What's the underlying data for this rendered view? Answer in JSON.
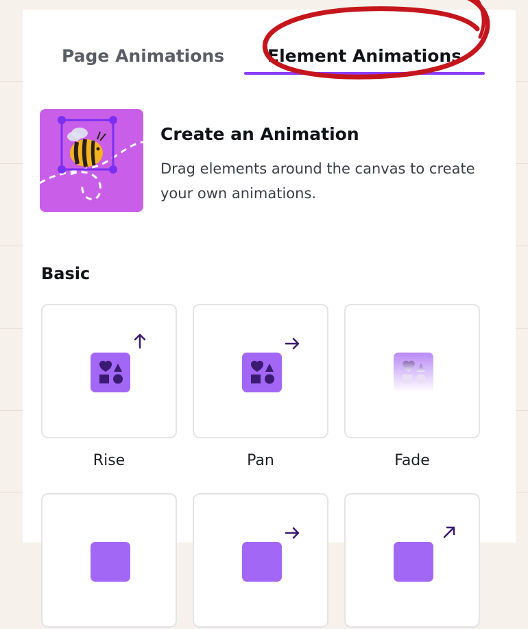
{
  "tabs": [
    {
      "label": "Page Animations",
      "active": false
    },
    {
      "label": "Element Animations",
      "active": true
    }
  ],
  "create": {
    "title": "Create an Animation",
    "description": "Drag elements around the canvas to create your own animations."
  },
  "section": {
    "title": "Basic"
  },
  "animations": [
    {
      "label": "Rise",
      "icon": "shapes-arrow-up-icon"
    },
    {
      "label": "Pan",
      "icon": "shapes-arrow-right-icon"
    },
    {
      "label": "Fade",
      "icon": "shapes-fade-icon"
    },
    {
      "label": "",
      "icon": "shapes-icon"
    },
    {
      "label": "",
      "icon": "shapes-arrow-right-icon"
    },
    {
      "label": "",
      "icon": "shapes-arrow-up-right-icon"
    }
  ],
  "colors": {
    "accent": "#8b3dff",
    "annotation": "#c4161c",
    "thumbnail": "#c95fe8"
  }
}
